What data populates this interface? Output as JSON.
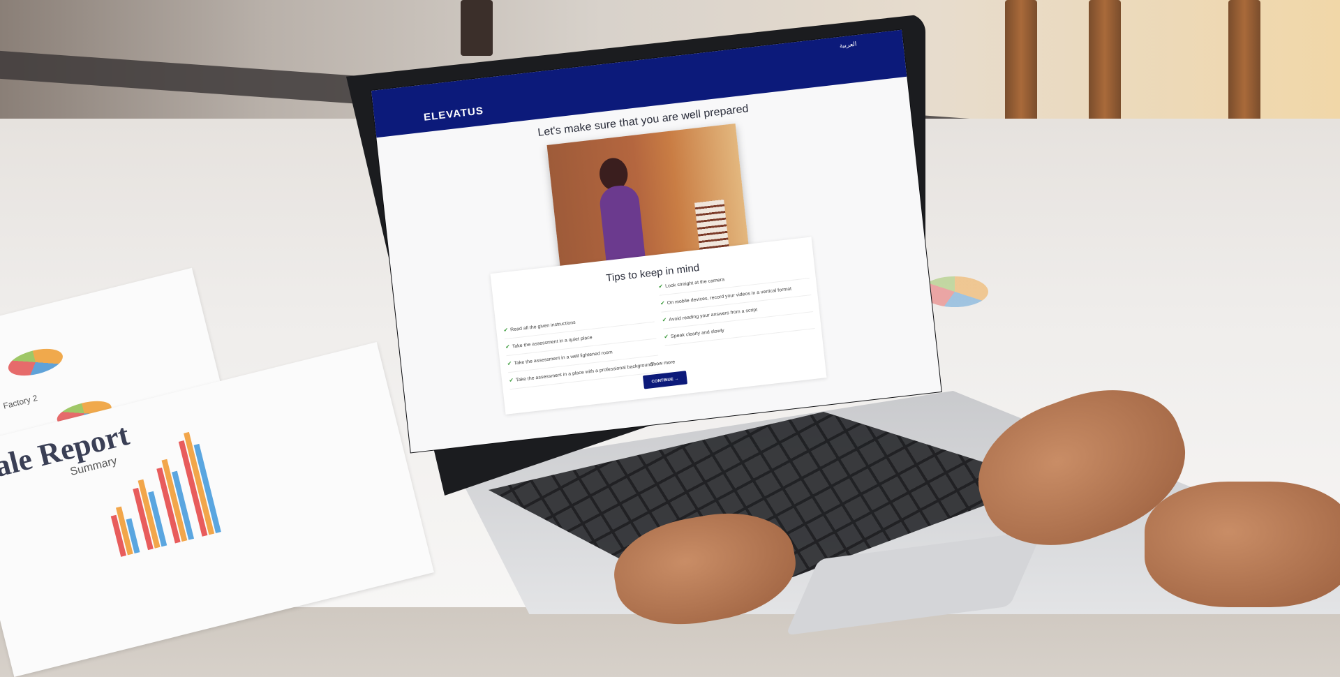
{
  "header": {
    "logo_text": "ELEVATUS",
    "language_link": "العربية"
  },
  "page": {
    "title": "Let's make sure that you are well prepared"
  },
  "video": {
    "icon": "video-preview"
  },
  "tips": {
    "title": "Tips to keep in mind",
    "left": [
      "Read all the given instructions",
      "Take the assessment in a quiet place",
      "Take the assessment in a well lightened room",
      "Take the assessment in a place with a professional background"
    ],
    "right": [
      "Look straight at the camera",
      "On mobile devices, record your videos in a vertical format",
      "Avoid reading your answers from a script",
      "Speak clearly and slowly"
    ],
    "show_more": "Show more"
  },
  "actions": {
    "continue_label": "CONTINUE →"
  },
  "background": {
    "report_title": "ale Report",
    "report_subtitle": "Summary",
    "factory_label": "Factory 2"
  },
  "colors": {
    "brand": "#0c1a7a",
    "check": "#3a9a3a"
  }
}
